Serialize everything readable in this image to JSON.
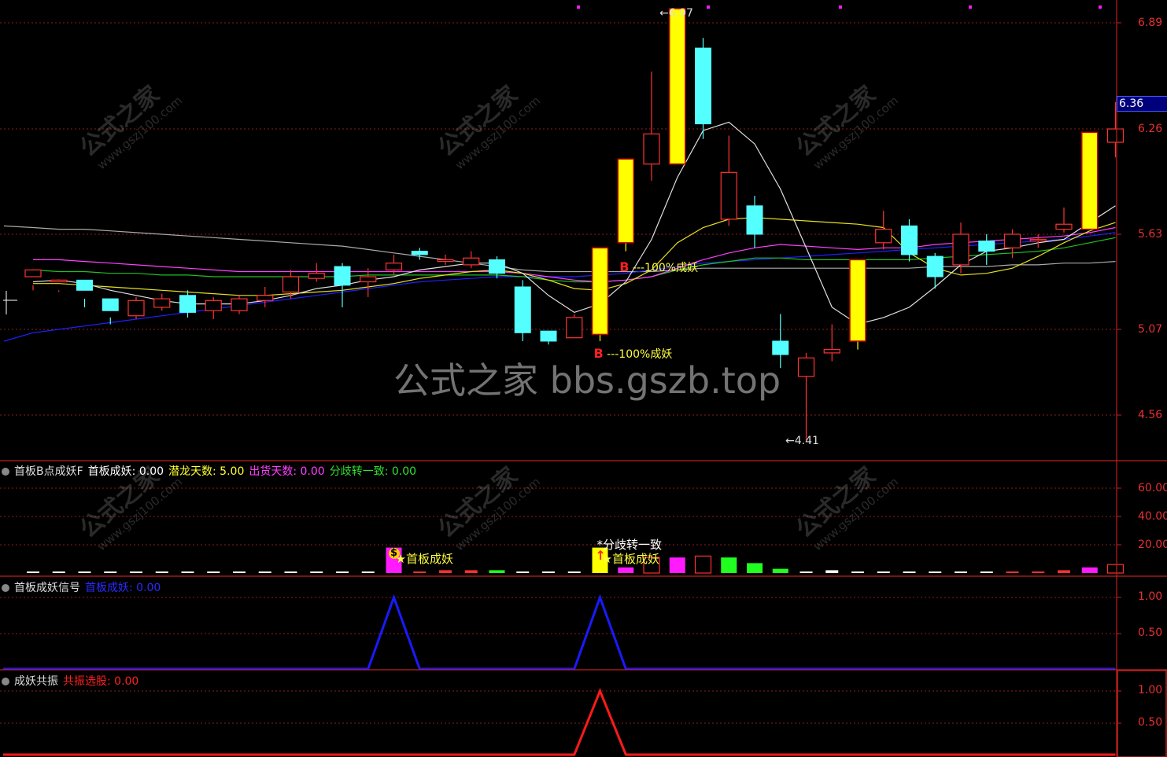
{
  "colors": {
    "up": "#ff3232",
    "down": "#54ffff",
    "limit": "#ffff00",
    "grid": "#8c1e1e",
    "axis": "#e83030",
    "ma5": "#e0e0e0",
    "ma10": "#e8e020",
    "ma20": "#ff40ff",
    "ma30": "#20c020",
    "ma60": "#2020ff",
    "ma120": "#aaaaaa",
    "magenta": "#ff1aff"
  },
  "price_axis": {
    "ticks": [
      "6.89",
      "6.26",
      "5.63",
      "5.07",
      "4.56"
    ],
    "current": "6.36",
    "hi_label": "6.97",
    "lo_label": "4.41"
  },
  "main_chart": {
    "candles": [
      [
        5.38,
        5.42,
        5.33,
        5.3
      ],
      [
        5.35,
        5.36,
        5.3,
        5.29
      ],
      [
        5.36,
        5.3,
        5.25,
        5.2
      ],
      [
        5.25,
        5.18,
        5.14,
        5.1
      ],
      [
        5.15,
        5.24,
        5.26,
        5.13
      ],
      [
        5.2,
        5.25,
        5.28,
        5.18
      ],
      [
        5.27,
        5.17,
        5.3,
        5.14
      ],
      [
        5.18,
        5.24,
        5.26,
        5.13
      ],
      [
        5.18,
        5.25,
        5.27,
        5.16
      ],
      [
        5.24,
        5.27,
        5.32,
        5.2
      ],
      [
        5.29,
        5.38,
        5.42,
        5.25
      ],
      [
        5.37,
        5.4,
        5.46,
        5.35
      ],
      [
        5.44,
        5.33,
        5.46,
        5.2
      ],
      [
        5.35,
        5.38,
        5.43,
        5.26
      ],
      [
        5.42,
        5.46,
        5.51,
        5.39
      ],
      [
        5.53,
        5.51,
        5.55,
        5.48
      ],
      [
        5.47,
        5.48,
        5.51,
        5.45
      ],
      [
        5.45,
        5.49,
        5.53,
        5.43
      ],
      [
        5.48,
        5.4,
        5.5,
        5.37
      ],
      [
        5.32,
        5.05,
        5.36,
        5.0
      ],
      [
        5.06,
        5.0,
        5.06,
        4.98
      ],
      [
        5.02,
        5.14,
        5.16,
        5.02
      ],
      [
        5.04,
        5.55,
        5.55,
        5.0
      ],
      [
        5.58,
        6.08,
        6.08,
        5.53
      ],
      [
        6.05,
        6.23,
        6.6,
        5.95
      ],
      [
        6.05,
        6.98,
        6.98,
        6.05
      ],
      [
        6.74,
        6.29,
        6.8,
        6.2
      ],
      [
        5.72,
        6.0,
        6.22,
        5.68
      ],
      [
        5.8,
        5.63,
        5.86,
        5.55
      ],
      [
        5.0,
        4.92,
        5.16,
        4.84
      ],
      [
        4.79,
        4.9,
        4.93,
        4.41
      ],
      [
        4.93,
        4.95,
        5.1,
        4.88
      ],
      [
        5.0,
        5.48,
        5.48,
        4.95
      ],
      [
        5.58,
        5.66,
        5.77,
        5.54
      ],
      [
        5.68,
        5.51,
        5.72,
        5.47
      ],
      [
        5.5,
        5.38,
        5.52,
        5.31
      ],
      [
        5.45,
        5.63,
        5.7,
        5.4
      ],
      [
        5.59,
        5.53,
        5.63,
        5.45
      ],
      [
        5.55,
        5.63,
        5.66,
        5.49
      ],
      [
        5.6,
        5.6,
        5.63,
        5.55
      ],
      [
        5.66,
        5.69,
        5.79,
        5.64
      ],
      [
        5.66,
        6.24,
        6.24,
        5.66
      ],
      [
        6.18,
        6.26,
        6.42,
        6.09
      ]
    ],
    "ma5": [
      5.35,
      5.36,
      5.34,
      5.3,
      5.27,
      5.24,
      5.22,
      5.22,
      5.22,
      5.24,
      5.27,
      5.31,
      5.33,
      5.36,
      5.38,
      5.42,
      5.44,
      5.46,
      5.46,
      5.4,
      5.27,
      5.17,
      5.22,
      5.35,
      5.6,
      5.97,
      6.25,
      6.3,
      6.17,
      5.9,
      5.55,
      5.2,
      5.1,
      5.14,
      5.2,
      5.32,
      5.45,
      5.53,
      5.55,
      5.58,
      5.6,
      5.7,
      5.8
    ],
    "ma10": [
      5.34,
      5.34,
      5.33,
      5.32,
      5.31,
      5.3,
      5.29,
      5.28,
      5.27,
      5.27,
      5.28,
      5.29,
      5.3,
      5.32,
      5.34,
      5.37,
      5.39,
      5.41,
      5.42,
      5.4,
      5.36,
      5.31,
      5.3,
      5.34,
      5.42,
      5.58,
      5.67,
      5.72,
      5.73,
      5.72,
      5.71,
      5.7,
      5.69,
      5.67,
      5.52,
      5.43,
      5.39,
      5.4,
      5.43,
      5.5,
      5.58,
      5.65,
      5.7
    ],
    "ma20": [
      5.48,
      5.48,
      5.47,
      5.46,
      5.45,
      5.44,
      5.43,
      5.42,
      5.41,
      5.41,
      5.41,
      5.41,
      5.41,
      5.41,
      5.41,
      5.41,
      5.41,
      5.41,
      5.41,
      5.4,
      5.38,
      5.36,
      5.35,
      5.36,
      5.38,
      5.43,
      5.48,
      5.52,
      5.55,
      5.57,
      5.56,
      5.55,
      5.54,
      5.55,
      5.55,
      5.57,
      5.58,
      5.59,
      5.6,
      5.61,
      5.62,
      5.64,
      5.67
    ],
    "ma30": [
      5.42,
      5.41,
      5.41,
      5.4,
      5.4,
      5.39,
      5.39,
      5.38,
      5.38,
      5.38,
      5.38,
      5.38,
      5.38,
      5.39,
      5.39,
      5.39,
      5.39,
      5.39,
      5.39,
      5.38,
      5.36,
      5.35,
      5.35,
      5.36,
      5.38,
      5.42,
      5.45,
      5.47,
      5.49,
      5.49,
      5.48,
      5.48,
      5.48,
      5.48,
      5.48,
      5.49,
      5.5,
      5.51,
      5.52,
      5.53,
      5.55,
      5.58,
      5.61
    ],
    "ma60": [
      5.05,
      5.07,
      5.09,
      5.11,
      5.13,
      5.15,
      5.17,
      5.19,
      5.21,
      5.23,
      5.25,
      5.27,
      5.29,
      5.31,
      5.33,
      5.35,
      5.36,
      5.37,
      5.38,
      5.38,
      5.38,
      5.38,
      5.39,
      5.4,
      5.42,
      5.44,
      5.46,
      5.47,
      5.48,
      5.49,
      5.5,
      5.51,
      5.52,
      5.53,
      5.54,
      5.55,
      5.56,
      5.57,
      5.58,
      5.59,
      5.6,
      5.62,
      5.64
    ],
    "ma120": [
      5.67,
      5.66,
      5.66,
      5.65,
      5.64,
      5.63,
      5.62,
      5.61,
      5.6,
      5.59,
      5.58,
      5.57,
      5.56,
      5.54,
      5.52,
      5.5,
      5.48,
      5.46,
      5.44,
      5.42,
      5.41,
      5.41,
      5.41,
      5.41,
      5.41,
      5.42,
      5.43,
      5.43,
      5.43,
      5.43,
      5.43,
      5.43,
      5.43,
      5.43,
      5.43,
      5.44,
      5.44,
      5.44,
      5.45,
      5.45,
      5.46,
      5.46,
      5.47
    ],
    "annotations": [
      {
        "i": 22,
        "price": 4.98,
        "letter": "B",
        "text": "---100%成妖"
      },
      {
        "i": 23,
        "price": 5.5,
        "letter": "B",
        "text": "---100%成妖"
      }
    ]
  },
  "panel1": {
    "title": "首板B点成妖F",
    "f1_label": "首板成妖: 0.00",
    "f2_label": "潜龙天数: 5.00",
    "f3_label": "出货天数: 0.00",
    "f4_label": "分歧转一致: 0.00",
    "ticks": [
      "60.00",
      "40.00",
      "20.00"
    ],
    "bars": [
      [
        "w",
        1
      ],
      [
        "w",
        1
      ],
      [
        "w",
        1
      ],
      [
        "w",
        1
      ],
      [
        "w",
        1
      ],
      [
        "w",
        1
      ],
      [
        "w",
        1
      ],
      [
        "w",
        1
      ],
      [
        "w",
        1
      ],
      [
        "w",
        1
      ],
      [
        "w",
        1
      ],
      [
        "w",
        1
      ],
      [
        "w",
        1
      ],
      [
        "w",
        0.5
      ],
      [
        "m",
        18
      ],
      [
        "r",
        1
      ],
      [
        "r",
        2
      ],
      [
        "r",
        2
      ],
      [
        "g",
        2
      ],
      [
        "w",
        0.5
      ],
      [
        "w",
        1
      ],
      [
        "w",
        1
      ],
      [
        "y",
        18
      ],
      [
        "m",
        4
      ],
      [
        "ro",
        11
      ],
      [
        "m",
        11
      ],
      [
        "ro",
        12
      ],
      [
        "g",
        11
      ],
      [
        "g",
        7
      ],
      [
        "g",
        3
      ],
      [
        "w",
        0.5
      ],
      [
        "w",
        2
      ],
      [
        "w",
        1
      ],
      [
        "w",
        1
      ],
      [
        "w",
        1
      ],
      [
        "w",
        1
      ],
      [
        "w",
        0.5
      ],
      [
        "w",
        0.5
      ],
      [
        "r",
        1
      ],
      [
        "r",
        1
      ],
      [
        "r",
        2
      ],
      [
        "m",
        4
      ],
      [
        "ro",
        6
      ]
    ],
    "labels": [
      {
        "i": 14,
        "text": "首板成妖"
      },
      {
        "i": 22,
        "text": "首板成妖"
      },
      {
        "i": 22,
        "text": "*分歧转一致"
      }
    ]
  },
  "panel2": {
    "title": "首板成妖信号",
    "f1_label": "首板成妖: 0.00",
    "ticks": [
      "1.00",
      "0.50"
    ],
    "peaks": [
      14,
      22
    ]
  },
  "panel3": {
    "title": "成妖共振",
    "f1_label": "共振选股: 0.00",
    "ticks": [
      "1.00",
      "0.50"
    ],
    "peaks": [
      22
    ]
  },
  "watermark": {
    "main": "公式之家 bbs.gszb.top",
    "diag": "公式之家",
    "diag_url": "www.gszj100.com"
  }
}
